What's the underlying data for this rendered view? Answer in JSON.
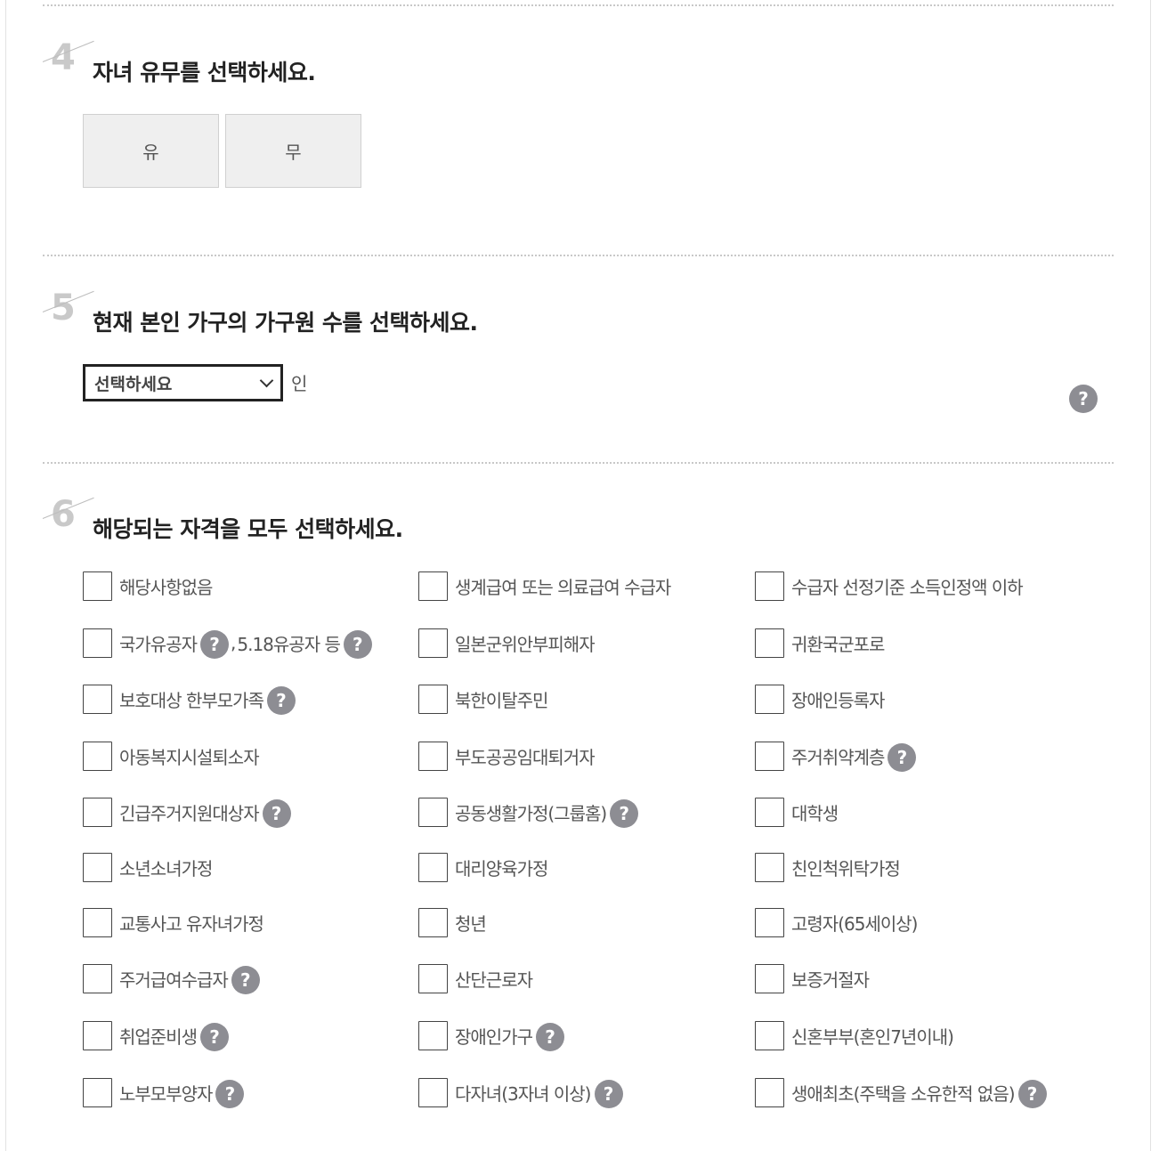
{
  "q4": {
    "number": "4",
    "title": "자녀 유무를 선택하세요.",
    "options": [
      "유",
      "무"
    ]
  },
  "q5": {
    "number": "5",
    "title": "현재 본인 가구의 가구원 수를 선택하세요.",
    "select_value": "선택하세요",
    "unit": "인",
    "help": "?"
  },
  "q6": {
    "number": "6",
    "title": "해당되는 자격을 모두 선택하세요.",
    "help": "?",
    "separator": ",",
    "col1": [
      "해당사항없음",
      "국가유공자",
      "보호대상 한부모가족",
      "아동복지시설퇴소자",
      "긴급주거지원대상자",
      "소년소녀가정",
      "교통사고 유자녀가정",
      "주거급여수급자",
      "취업준비생",
      "노부모부양자"
    ],
    "col1_extra": "5.18유공자 등",
    "col2": [
      "생계급여 또는 의료급여 수급자",
      "일본군위안부피해자",
      "북한이탈주민",
      "부도공공임대퇴거자",
      "공동생활가정(그룹홈)",
      "대리양육가정",
      "청년",
      "산단근로자",
      "장애인가구",
      "다자녀(3자녀 이상)"
    ],
    "col3": [
      "수급자 선정기준 소득인정액 이하",
      "귀환국군포로",
      "장애인등록자",
      "주거취약계층",
      "대학생",
      "친인척위탁가정",
      "고령자(65세이상)",
      "보증거절자",
      "신혼부부(혼인7년이내)",
      "생애최초(주택을 소유한적 없음)"
    ]
  }
}
